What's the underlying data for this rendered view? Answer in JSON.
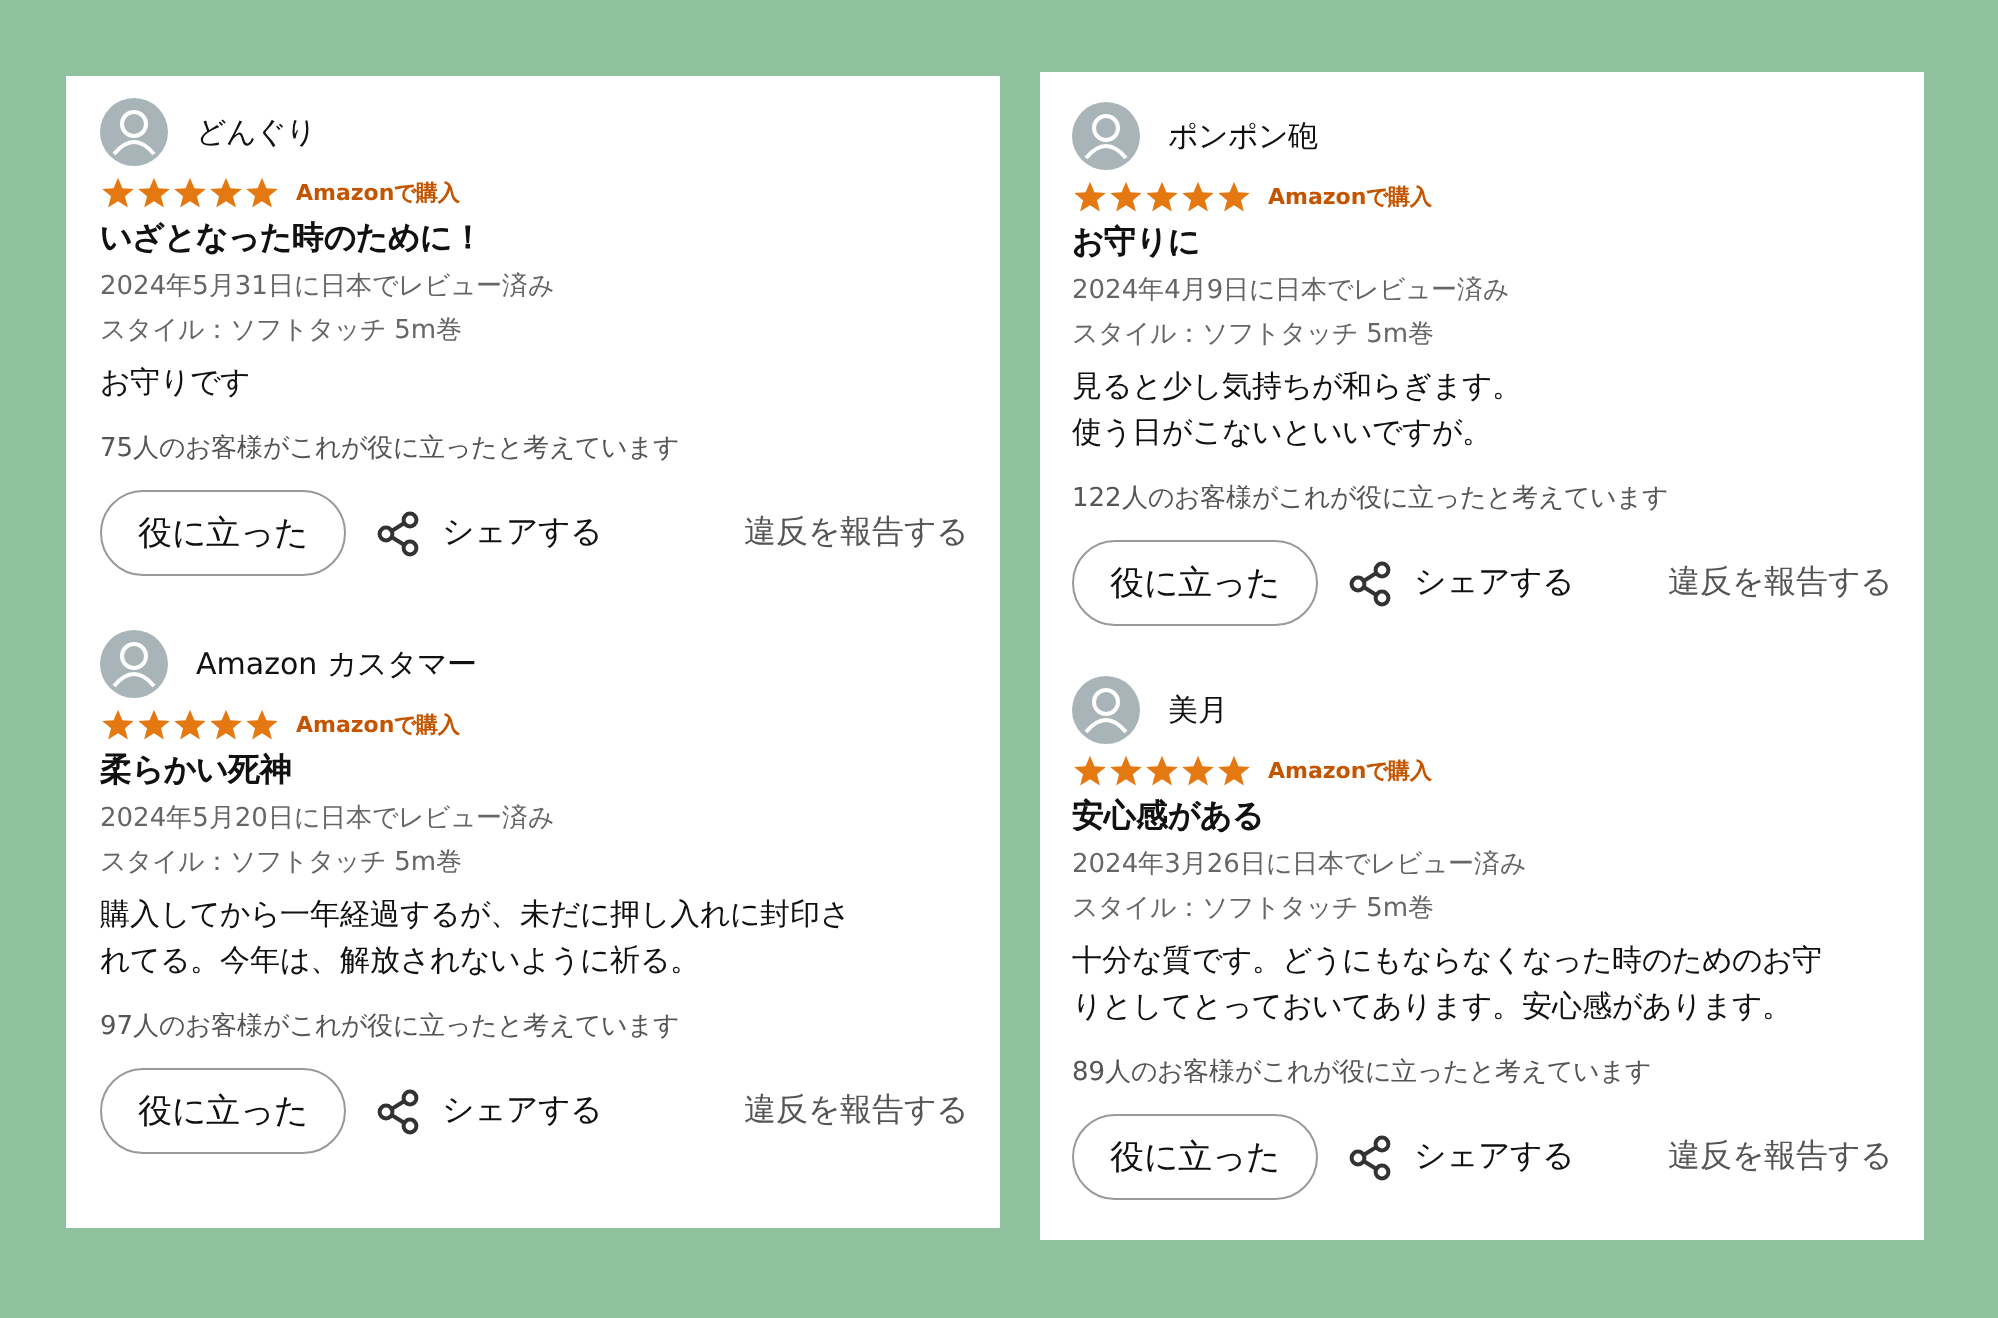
{
  "panels": [
    {
      "reviews": [
        {
          "author": "どんぐり",
          "stars": 5,
          "badge": "Amazonで購入",
          "title": "いざとなった時のために！",
          "date": "2024年5月31日に日本でレビュー済み",
          "style": "スタイル：ソフトタッチ 5m巻",
          "body": [
            "お守りです"
          ],
          "helpful_count": "75人のお客様がこれが役に立ったと考えています",
          "helpful_button": "役に立った",
          "share": "シェアする",
          "report": "違反を報告する"
        },
        {
          "author": "Amazon カスタマー",
          "stars": 5,
          "badge": "Amazonで購入",
          "title": "柔らかい死神",
          "date": "2024年5月20日に日本でレビュー済み",
          "style": "スタイル：ソフトタッチ 5m巻",
          "body": [
            "購入してから一年経過するが、未だに押し入れに封印さ",
            "れてる。今年は、解放されないように祈る。"
          ],
          "helpful_count": "97人のお客様がこれが役に立ったと考えています",
          "helpful_button": "役に立った",
          "share": "シェアする",
          "report": "違反を報告する"
        }
      ]
    },
    {
      "reviews": [
        {
          "author": "ポンポン砲",
          "stars": 5,
          "badge": "Amazonで購入",
          "title": "お守りに",
          "date": "2024年4月9日に日本でレビュー済み",
          "style": "スタイル：ソフトタッチ 5m巻",
          "body": [
            "見ると少し気持ちが和らぎます。",
            "使う日がこないといいですが。"
          ],
          "helpful_count": "122人のお客様がこれが役に立ったと考えています",
          "helpful_button": "役に立った",
          "share": "シェアする",
          "report": "違反を報告する"
        },
        {
          "author": "美月",
          "stars": 5,
          "badge": "Amazonで購入",
          "title": "安心感がある",
          "date": "2024年3月26日に日本でレビュー済み",
          "style": "スタイル：ソフトタッチ 5m巻",
          "body": [
            "十分な質です。どうにもならなくなった時のためのお守",
            "りとしてとっておいてあります。安心感があります。"
          ],
          "helpful_count": "89人のお客様がこれが役に立ったと考えています",
          "helpful_button": "役に立った",
          "share": "シェアする",
          "report": "違反を報告する"
        }
      ]
    }
  ]
}
